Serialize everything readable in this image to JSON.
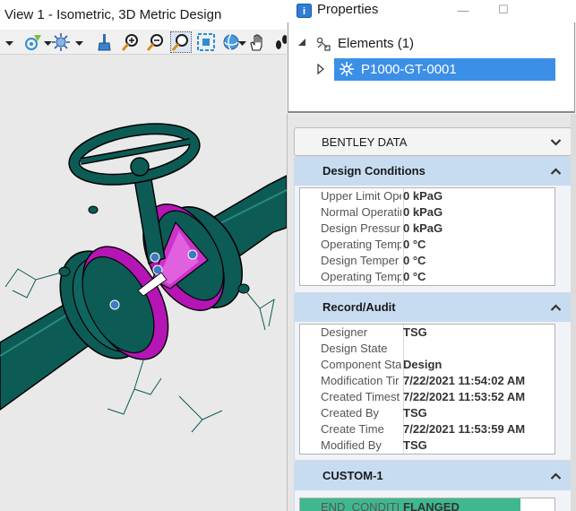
{
  "view": {
    "title": "View 1 - Isometric, 3D Metric Design",
    "toolbar": [
      {
        "name": "snaps-icon"
      },
      {
        "name": "display-style-icon"
      },
      {
        "name": "brush-icon"
      },
      {
        "name": "zoom-in-icon"
      },
      {
        "name": "zoom-out-icon"
      },
      {
        "name": "window-area-icon"
      },
      {
        "name": "fit-view-icon"
      },
      {
        "name": "rotate-view-icon"
      },
      {
        "name": "pan-hand-icon"
      },
      {
        "name": "walk-icon"
      }
    ],
    "model": {
      "pipe_color": "#0d5b55",
      "pipe_edge_color": "#000000",
      "flange_accent_color": "#cc00cc",
      "background": "#e9e9e9"
    }
  },
  "properties": {
    "title": "Properties",
    "window_controls": {
      "minimize": "—",
      "maximize": "☐"
    },
    "tree": {
      "root": {
        "label": "Elements (1)",
        "icon": "elements-icon"
      },
      "child": {
        "label": "P1000-GT-0001",
        "icon": "valve-icon"
      }
    },
    "sections": {
      "bentley": {
        "label": "BENTLEY DATA"
      },
      "design": {
        "label": "Design Conditions",
        "rows": [
          {
            "name": "Upper Limit Ope",
            "value": "0 kPaG"
          },
          {
            "name": "Normal Operatir",
            "value": "0 kPaG"
          },
          {
            "name": "Design Pressur",
            "value": "0 kPaG"
          },
          {
            "name": "Operating Temp",
            "value": "0 °C"
          },
          {
            "name": "Design Temper",
            "value": "0 °C"
          },
          {
            "name": "Operating Temp",
            "value": "0 °C"
          }
        ]
      },
      "record": {
        "label": "Record/Audit",
        "rows": [
          {
            "name": "Designer",
            "value": "TSG"
          },
          {
            "name": "Design State",
            "value": ""
          },
          {
            "name": "Component Sta",
            "value": "Design"
          },
          {
            "name": "Modification Tir",
            "value": "7/22/2021 11:54:02 AM"
          },
          {
            "name": "Created Timest",
            "value": "7/22/2021 11:53:52 AM"
          },
          {
            "name": "Created By",
            "value": "TSG"
          },
          {
            "name": "Create Time",
            "value": "7/22/2021 11:53:59 AM"
          },
          {
            "name": "Modified By",
            "value": "TSG"
          }
        ]
      },
      "custom": {
        "label": "CUSTOM-1",
        "rows": [
          {
            "name": "END_CONDITI",
            "value": "FLANGED"
          }
        ]
      }
    },
    "colors": {
      "selection": "#3c8fe6",
      "section_header": "#c8dcf1",
      "highlight": "#3fb890"
    }
  }
}
